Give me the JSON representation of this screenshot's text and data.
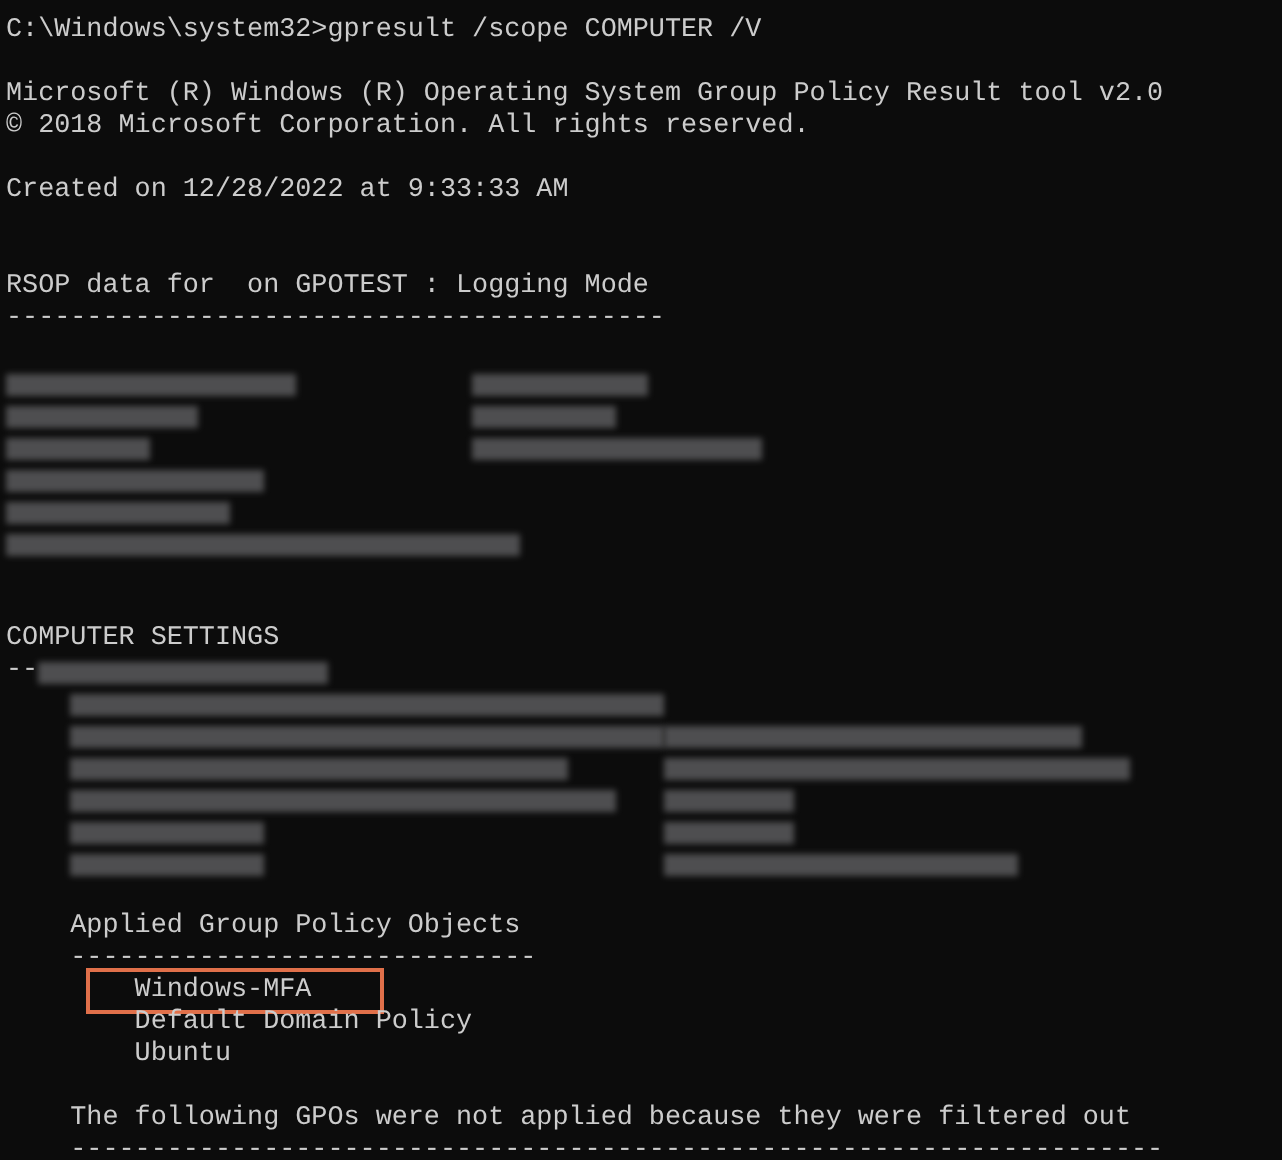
{
  "console": {
    "lines": [
      {
        "kind": "text",
        "text": "C:\\Windows\\system32>gpresult /scope COMPUTER /V"
      },
      {
        "kind": "blank"
      },
      {
        "kind": "text",
        "text": "Microsoft (R) Windows (R) Operating System Group Policy Result tool v2.0"
      },
      {
        "kind": "text",
        "text": "© 2018 Microsoft Corporation. All rights reserved."
      },
      {
        "kind": "blank"
      },
      {
        "kind": "text",
        "text": "Created on ‎12/‎28/‎2022 at 9:33:33 AM"
      },
      {
        "kind": "blank"
      },
      {
        "kind": "blank"
      },
      {
        "kind": "text",
        "text": "RSOP data for  on GPOTEST : Logging Mode"
      },
      {
        "kind": "text",
        "text": "-----------------------------------------"
      },
      {
        "kind": "blank"
      },
      {
        "kind": "redacted"
      },
      {
        "kind": "redacted"
      },
      {
        "kind": "redacted"
      },
      {
        "kind": "redacted"
      },
      {
        "kind": "redacted"
      },
      {
        "kind": "redacted"
      },
      {
        "kind": "blank"
      },
      {
        "kind": "blank"
      },
      {
        "kind": "text",
        "text": "COMPUTER SETTINGS"
      },
      {
        "kind": "partly_redacted",
        "text": "--"
      },
      {
        "kind": "redacted"
      },
      {
        "kind": "redacted"
      },
      {
        "kind": "redacted"
      },
      {
        "kind": "redacted"
      },
      {
        "kind": "redacted"
      },
      {
        "kind": "redacted"
      },
      {
        "kind": "blank"
      },
      {
        "kind": "text",
        "text": "    Applied Group Policy Objects"
      },
      {
        "kind": "text",
        "text": "    -----------------------------"
      },
      {
        "kind": "text",
        "text": "        Windows-MFA",
        "highlighted": true
      },
      {
        "kind": "text",
        "text": "        Default Domain Policy"
      },
      {
        "kind": "text",
        "text": "        Ubuntu"
      },
      {
        "kind": "blank"
      },
      {
        "kind": "text",
        "text": "    The following GPOs were not applied because they were filtered out"
      },
      {
        "kind": "text",
        "text": "    --------------------------------------------------------------------"
      }
    ]
  }
}
